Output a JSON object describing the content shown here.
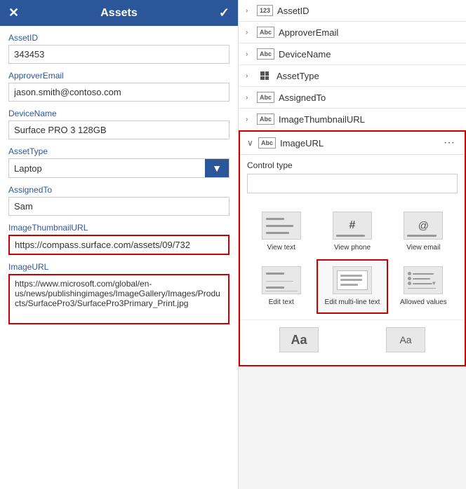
{
  "left": {
    "header": {
      "title": "Assets",
      "close_icon": "×",
      "check_icon": "✓"
    },
    "fields": [
      {
        "label": "AssetID",
        "type": "input",
        "value": "343453",
        "highlighted": false
      },
      {
        "label": "ApproverEmail",
        "type": "input",
        "value": "jason.smith@contoso.com",
        "highlighted": false
      },
      {
        "label": "DeviceName",
        "type": "input",
        "value": "Surface PRO 3 128GB",
        "highlighted": false
      },
      {
        "label": "AssetType",
        "type": "select",
        "value": "Laptop",
        "highlighted": false
      },
      {
        "label": "AssignedTo",
        "type": "input",
        "value": "Sam",
        "highlighted": false
      },
      {
        "label": "ImageThumbnailURL",
        "type": "input",
        "value": "https://compass.surface.com/assets/09/732",
        "highlighted": true
      },
      {
        "label": "ImageURL",
        "type": "textarea",
        "value": "https://www.microsoft.com/global/en-us/news/publishingimages/ImageGallery/Images/Products/SurfacePro3/SurfacePro3Primary_Print.jpg",
        "highlighted": true
      }
    ]
  },
  "right": {
    "field_list": [
      {
        "expand": "›",
        "type": "123",
        "name": "AssetID"
      },
      {
        "expand": "›",
        "type": "Abc",
        "name": "ApproverEmail"
      },
      {
        "expand": "›",
        "type": "Abc",
        "name": "DeviceName"
      },
      {
        "expand": "›",
        "type": "grid",
        "name": "AssetType"
      },
      {
        "expand": "›",
        "type": "Abc",
        "name": "AssignedTo"
      },
      {
        "expand": "›",
        "type": "Abc",
        "name": "ImageThumbnailURL"
      }
    ],
    "imageurl_section": {
      "expand": "∨",
      "type": "Abc",
      "name": "ImageURL",
      "dots": "···",
      "control_type_label": "Control type",
      "controls": [
        {
          "id": "view-text",
          "label": "View text",
          "type": "lines",
          "selected": false
        },
        {
          "id": "view-phone",
          "label": "View phone",
          "type": "hash",
          "selected": false
        },
        {
          "id": "view-email",
          "label": "View email",
          "type": "at",
          "selected": false
        },
        {
          "id": "edit-text",
          "label": "Edit text",
          "type": "editlines",
          "selected": false
        },
        {
          "id": "edit-multiline",
          "label": "Edit multi-line text",
          "type": "multiline",
          "selected": true
        },
        {
          "id": "allowed-values",
          "label": "Allowed values",
          "type": "allowed",
          "selected": false
        }
      ],
      "bottom_controls": [
        {
          "id": "font-large",
          "label": "",
          "type": "font-large"
        },
        {
          "id": "font-small",
          "label": "",
          "type": "font-small"
        }
      ]
    }
  }
}
